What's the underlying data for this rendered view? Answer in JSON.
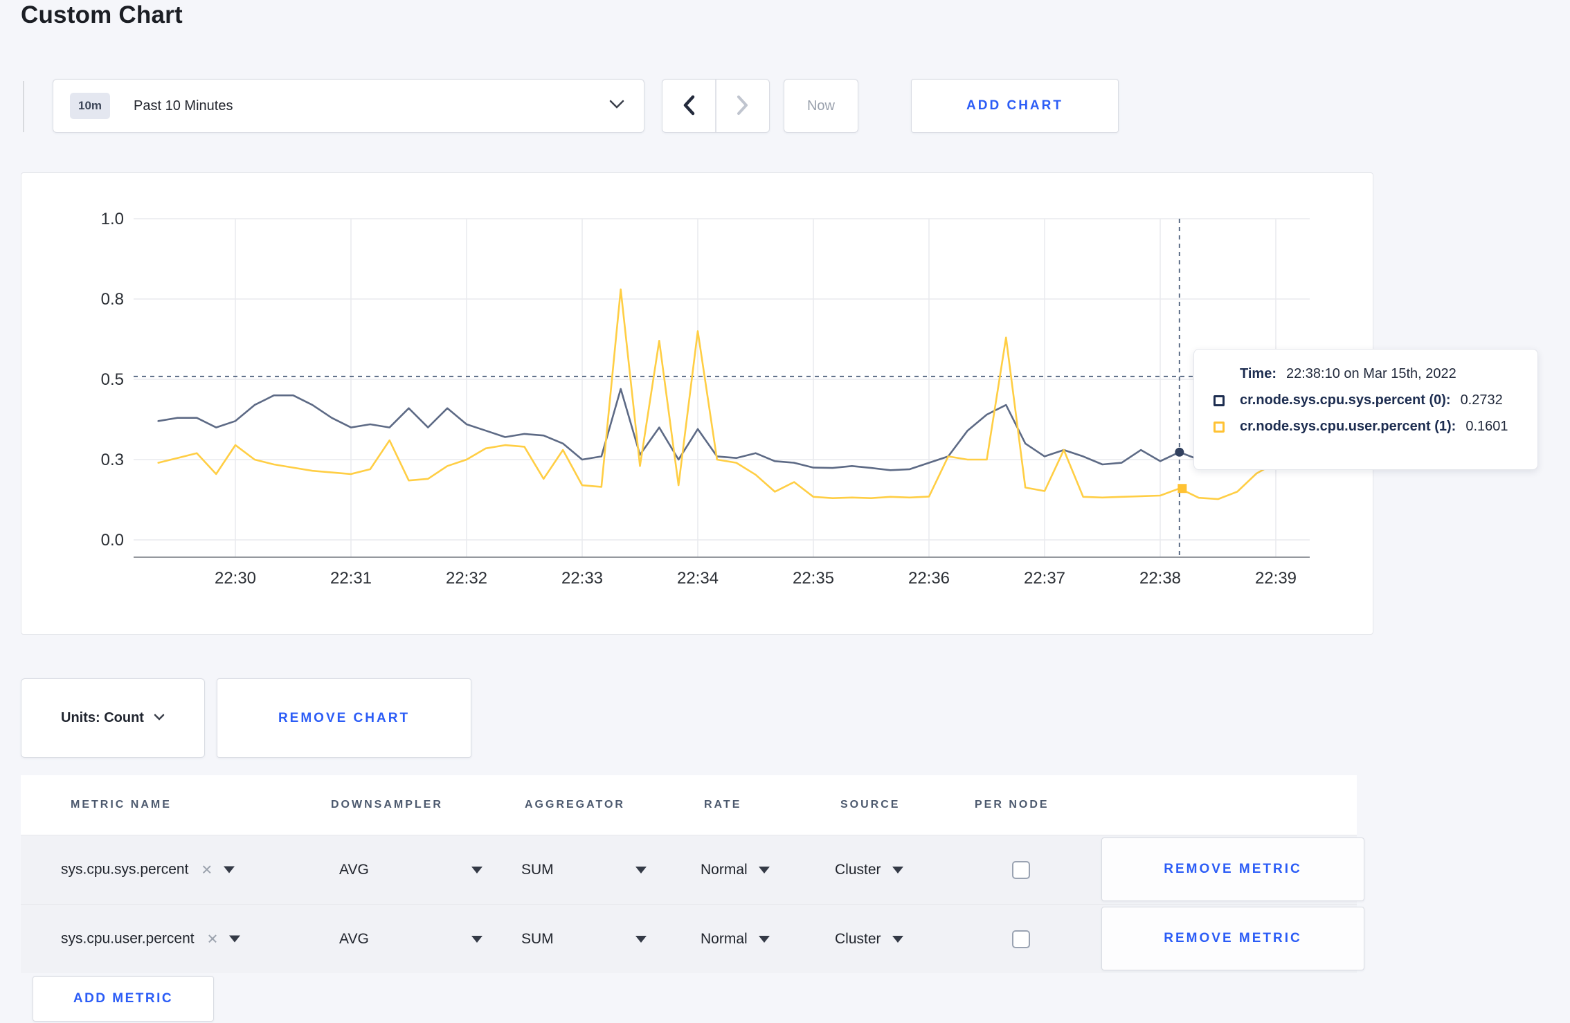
{
  "page": {
    "title": "Custom Chart",
    "background": "#f5f6fa",
    "accent_color": "#2b5cf6"
  },
  "toolbar": {
    "range_badge": "10m",
    "range_label": "Past 10 Minutes",
    "back_icon": "chevron-left",
    "forward_icon": "chevron-right",
    "now_label": "Now",
    "add_chart_label": "ADD CHART"
  },
  "tooltip": {
    "time_label": "Time:",
    "time_value": "22:38:10 on Mar 15th, 2022",
    "rows": [
      {
        "label": "cr.node.sys.cpu.sys.percent (0):",
        "value": "0.2732",
        "swatch_color": "#1d2d50"
      },
      {
        "label": "cr.node.sys.cpu.user.percent (1):",
        "value": "0.1601",
        "swatch_color": "#ffc233"
      }
    ]
  },
  "chart_data": {
    "type": "line",
    "title": "",
    "x_start": "22:29:20",
    "x_interval_seconds": 10,
    "x_ticks": [
      "22:30",
      "22:31",
      "22:32",
      "22:33",
      "22:34",
      "22:35",
      "22:36",
      "22:37",
      "22:38",
      "22:39"
    ],
    "y_ticks": [
      {
        "value": 0.0,
        "label": "0.0"
      },
      {
        "value": 0.25,
        "label": "0.3"
      },
      {
        "value": 0.5,
        "label": "0.5"
      },
      {
        "value": 0.75,
        "label": "0.8"
      },
      {
        "value": 1.0,
        "label": "1.0"
      }
    ],
    "ylim": [
      0,
      1
    ],
    "grid": true,
    "legend_position": "tooltip",
    "series": [
      {
        "name": "cr.node.sys.cpu.sys.percent",
        "color": "#5d6a85",
        "marker_color": "#31405e",
        "values": [
          0.37,
          0.38,
          0.38,
          0.35,
          0.37,
          0.42,
          0.45,
          0.45,
          0.42,
          0.38,
          0.35,
          0.36,
          0.35,
          0.41,
          0.35,
          0.41,
          0.36,
          0.34,
          0.32,
          0.33,
          0.325,
          0.3,
          0.25,
          0.26,
          0.47,
          0.265,
          0.35,
          0.25,
          0.345,
          0.26,
          0.255,
          0.27,
          0.245,
          0.24,
          0.225,
          0.224,
          0.23,
          0.224,
          0.217,
          0.22,
          0.24,
          0.26,
          0.34,
          0.39,
          0.42,
          0.3,
          0.26,
          0.28,
          0.26,
          0.235,
          0.24,
          0.28,
          0.245,
          0.2732,
          0.25,
          0.26,
          0.25,
          0.26,
          0.25,
          0.26
        ]
      },
      {
        "name": "cr.node.sys.cpu.user.percent",
        "color": "#ffce44",
        "marker_color": "#ffc233",
        "values": [
          0.24,
          0.255,
          0.27,
          0.205,
          0.295,
          0.25,
          0.235,
          0.225,
          0.215,
          0.21,
          0.205,
          0.22,
          0.31,
          0.185,
          0.19,
          0.23,
          0.25,
          0.285,
          0.295,
          0.29,
          0.19,
          0.28,
          0.17,
          0.165,
          0.78,
          0.23,
          0.62,
          0.17,
          0.65,
          0.25,
          0.24,
          0.203,
          0.15,
          0.18,
          0.134,
          0.13,
          0.132,
          0.13,
          0.134,
          0.132,
          0.135,
          0.26,
          0.25,
          0.25,
          0.63,
          0.163,
          0.152,
          0.28,
          0.134,
          0.132,
          0.134,
          0.136,
          0.138,
          0.1601,
          0.131,
          0.127,
          0.15,
          0.207,
          0.24,
          0.27
        ]
      }
    ],
    "crosshair": {
      "time": "22:38:10",
      "x_index": 53,
      "h_line_value": 0.509,
      "highlight": [
        {
          "series": 0,
          "value": 0.2732
        },
        {
          "series": 1,
          "value": 0.1601
        }
      ]
    }
  },
  "controls": {
    "units_label": "Units: Count",
    "remove_chart_label": "REMOVE CHART",
    "add_metric_label": "ADD METRIC"
  },
  "table": {
    "headers": [
      "METRIC NAME",
      "DOWNSAMPLER",
      "AGGREGATOR",
      "RATE",
      "SOURCE",
      "PER NODE"
    ],
    "remove_metric_label": "REMOVE METRIC",
    "rows": [
      {
        "metric": "sys.cpu.sys.percent",
        "downsampler": "AVG",
        "aggregator": "SUM",
        "rate": "Normal",
        "source": "Cluster",
        "per_node_checked": false
      },
      {
        "metric": "sys.cpu.user.percent",
        "downsampler": "AVG",
        "aggregator": "SUM",
        "rate": "Normal",
        "source": "Cluster",
        "per_node_checked": false
      }
    ]
  }
}
